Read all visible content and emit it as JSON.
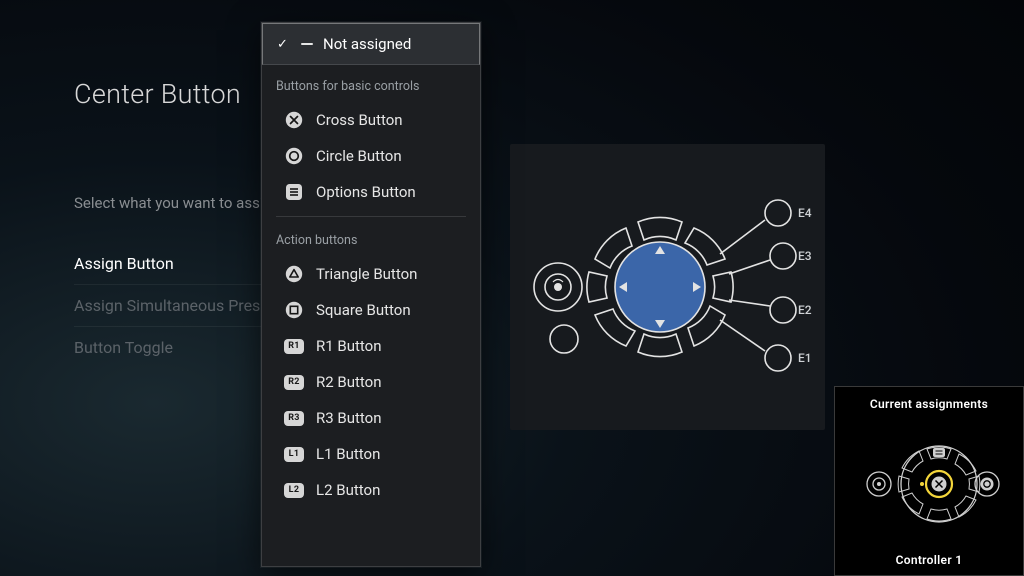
{
  "page": {
    "title": "Center Button",
    "subtitle": "Select what you want to assign to this button."
  },
  "leftOptions": {
    "assign": "Assign Button",
    "simultaneous": "Assign Simultaneous Press",
    "toggle": "Button Toggle"
  },
  "dropdown": {
    "selected": "Not assigned",
    "group1_title": "Buttons for basic controls",
    "group1": {
      "cross": "Cross Button",
      "circle": "Circle Button",
      "options": "Options Button"
    },
    "group2_title": "Action buttons",
    "group2": {
      "triangle": "Triangle Button",
      "square": "Square Button",
      "r1": "R1 Button",
      "r2": "R2 Button",
      "r3": "R3 Button",
      "l1": "L1 Button",
      "l2": "L2 Button"
    },
    "badges": {
      "r1": "R1",
      "r2": "R2",
      "r3": "R3",
      "l1": "L1",
      "l2": "L2"
    }
  },
  "diagram": {
    "expansion": {
      "e1": "E1",
      "e2": "E2",
      "e3": "E3",
      "e4": "E4"
    }
  },
  "assignments": {
    "header": "Current assignments",
    "footer": "Controller 1"
  },
  "colors": {
    "accent_blue": "#3b66a9",
    "highlight_yellow": "#f4d63b"
  }
}
